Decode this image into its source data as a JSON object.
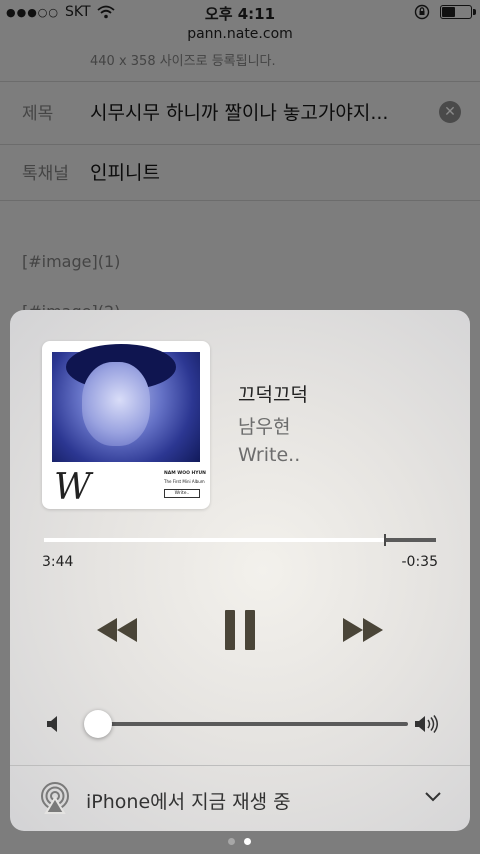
{
  "status_bar": {
    "carrier": "SKT",
    "time": "오후 4:11"
  },
  "browser": {
    "url": "pann.nate.com"
  },
  "page": {
    "size_hint": "440 x 358 사이즈로 등록됩니다.",
    "title_label": "제목",
    "title_value": "시무시무 하니까 짤이나 놓고가야지...",
    "channel_label": "톡채널",
    "channel_value": "인피니트",
    "image_tag_1": "[#image](1)",
    "image_tag_2": "[#image](2)"
  },
  "album_art": {
    "letter": "W",
    "artist_caps": "NAM WOO HYUN",
    "album_caption": "The First Mini Album",
    "album_script": "Write.."
  },
  "now_playing": {
    "song": "끄덕끄덕",
    "artist": "남우현",
    "album": "Write..",
    "elapsed": "3:44",
    "remaining": "-0:35",
    "progress": 0.87,
    "volume": 0.03
  },
  "airplay": {
    "label": "iPhone에서 지금 재생 중"
  },
  "pager": {
    "count": 2,
    "active": 1
  },
  "icons": [
    "wifi-icon",
    "orientation-lock-icon",
    "battery-icon",
    "clear-icon",
    "rewind-icon",
    "pause-icon",
    "fast-forward-icon",
    "volume-low-icon",
    "volume-high-icon",
    "airplay-icon",
    "chevron-down-icon"
  ],
  "colors": {
    "dim_overlay": "#7d7d7d",
    "track_fill": "#ffffff",
    "track": "#5b5b5b",
    "controls": "#4a4538"
  }
}
